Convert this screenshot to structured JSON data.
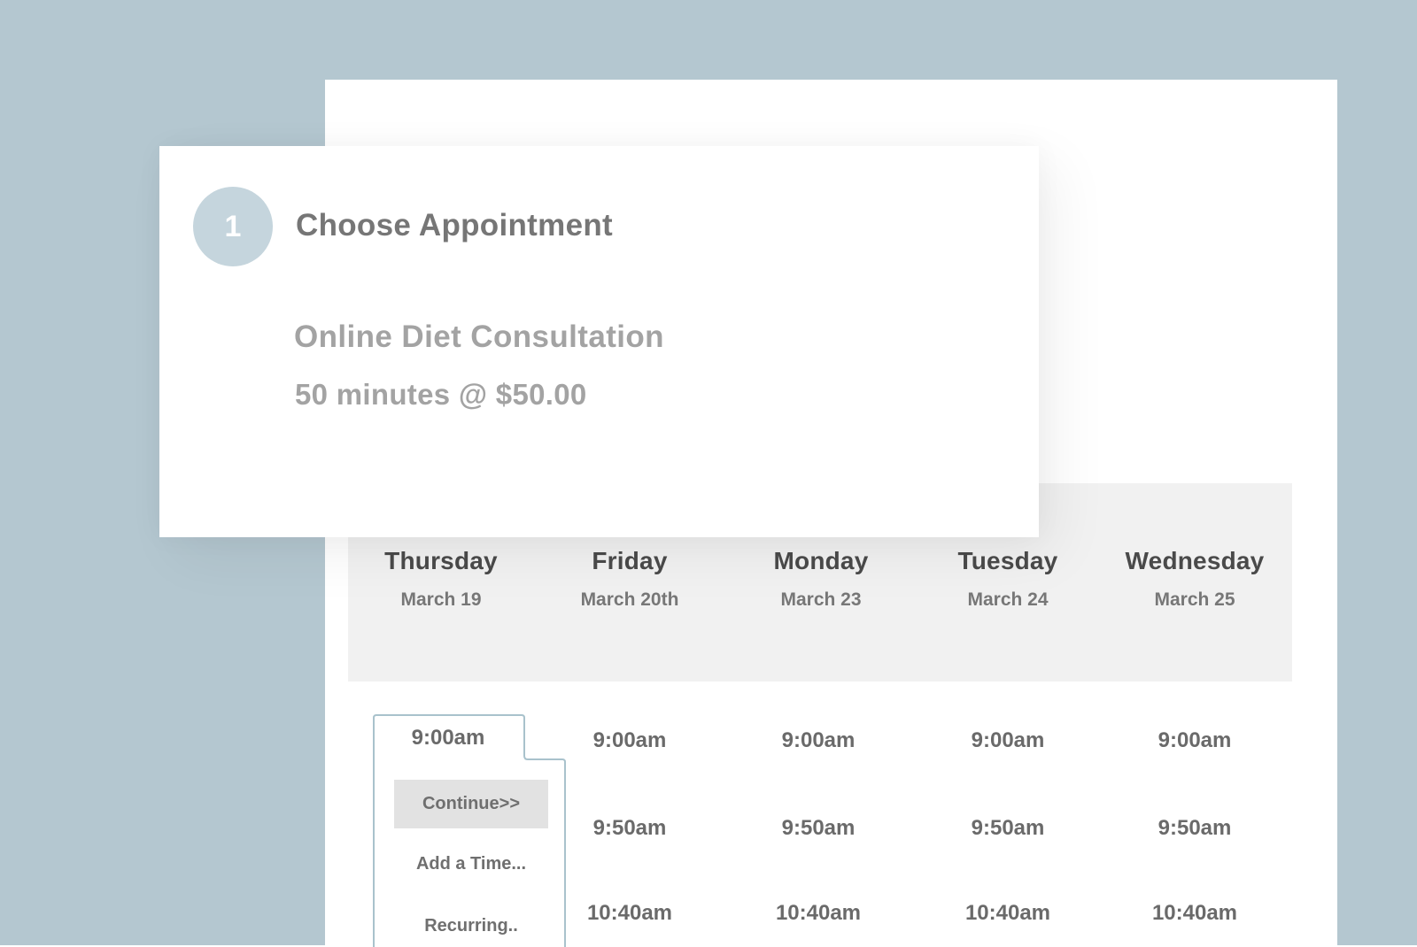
{
  "step": {
    "number": "1",
    "title": "Choose Appointment"
  },
  "service": {
    "name": "Online Diet Consultation",
    "detail": "50 minutes @ $50.00"
  },
  "days": [
    {
      "name": "Thursday",
      "date": "March 19"
    },
    {
      "name": "Friday",
      "date": "March 20th"
    },
    {
      "name": "Monday",
      "date": "March 23"
    },
    {
      "name": "Tuesday",
      "date": "March 24"
    },
    {
      "name": "Wednesday",
      "date": "March 25"
    }
  ],
  "slots": {
    "thursday": [
      "9:00am"
    ],
    "friday": [
      "9:00am",
      "9:50am",
      "10:40am"
    ],
    "monday": [
      "9:00am",
      "9:50am",
      "10:40am"
    ],
    "tuesday": [
      "9:00am",
      "9:50am",
      "10:40am"
    ],
    "wednesday": [
      "9:00am",
      "9:50am",
      "10:40am"
    ]
  },
  "selected_slot": {
    "time": "9:00am",
    "continue_label": "Continue>>",
    "add_time_label": "Add a Time...",
    "recurring_label": "Recurring.."
  },
  "colors": {
    "background": "#b4c7d0",
    "accent_circle": "#c5d5dd",
    "selected_outline": "#a9c2cc",
    "header_bg": "#f1f1f1"
  }
}
